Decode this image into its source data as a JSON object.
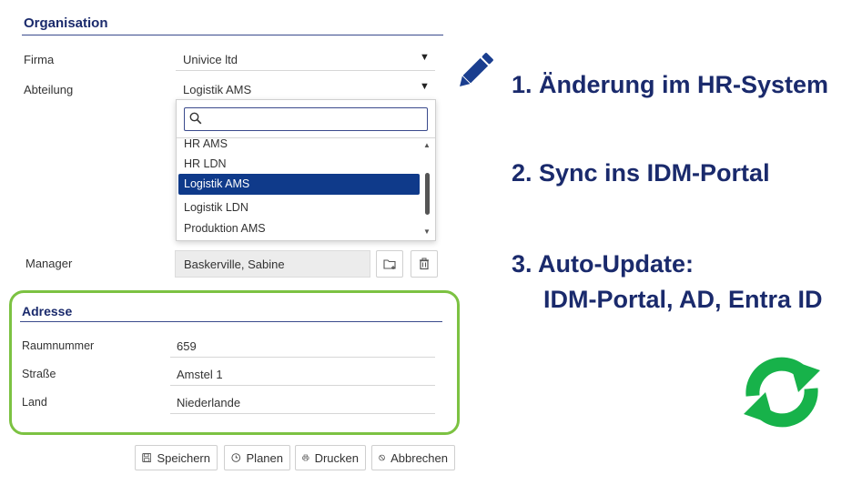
{
  "organisation": {
    "title": "Organisation",
    "firma_label": "Firma",
    "firma_value": "Univice ltd",
    "abteilung_label": "Abteilung",
    "abteilung_value": "Logistik AMS",
    "dropdown": {
      "search_placeholder": "",
      "items": [
        "HR AMS",
        "HR LDN",
        "Logistik AMS",
        "Logistik LDN",
        "Produktion AMS"
      ],
      "selected": "Logistik AMS"
    },
    "manager_label": "Manager",
    "manager_value": "Baskerville, Sabine"
  },
  "adresse": {
    "title": "Adresse",
    "raumnummer_label": "Raumnummer",
    "raumnummer_value": "659",
    "strasse_label": "Straße",
    "strasse_value": "Amstel 1",
    "land_label": "Land",
    "land_value": "Niederlande"
  },
  "buttons": {
    "save": "Speichern",
    "plan": "Planen",
    "print": "Drucken",
    "cancel": "Abbrechen"
  },
  "steps": {
    "step1": "1. Änderung im HR-System",
    "step2": "2. Sync ins IDM-Portal",
    "step3_line1": "3. Auto-Update:",
    "step3_line2": "IDM-Portal, AD, Entra ID"
  },
  "colors": {
    "accent": "#1a2a6c",
    "selected": "#0f3a8a",
    "green": "#7cc242",
    "sync_green": "#17b24a"
  },
  "icons": [
    "pencil-icon",
    "search-icon",
    "folder-add-icon",
    "trash-icon",
    "save-icon",
    "clock-icon",
    "printer-icon",
    "cancel-icon",
    "sync-icon"
  ]
}
